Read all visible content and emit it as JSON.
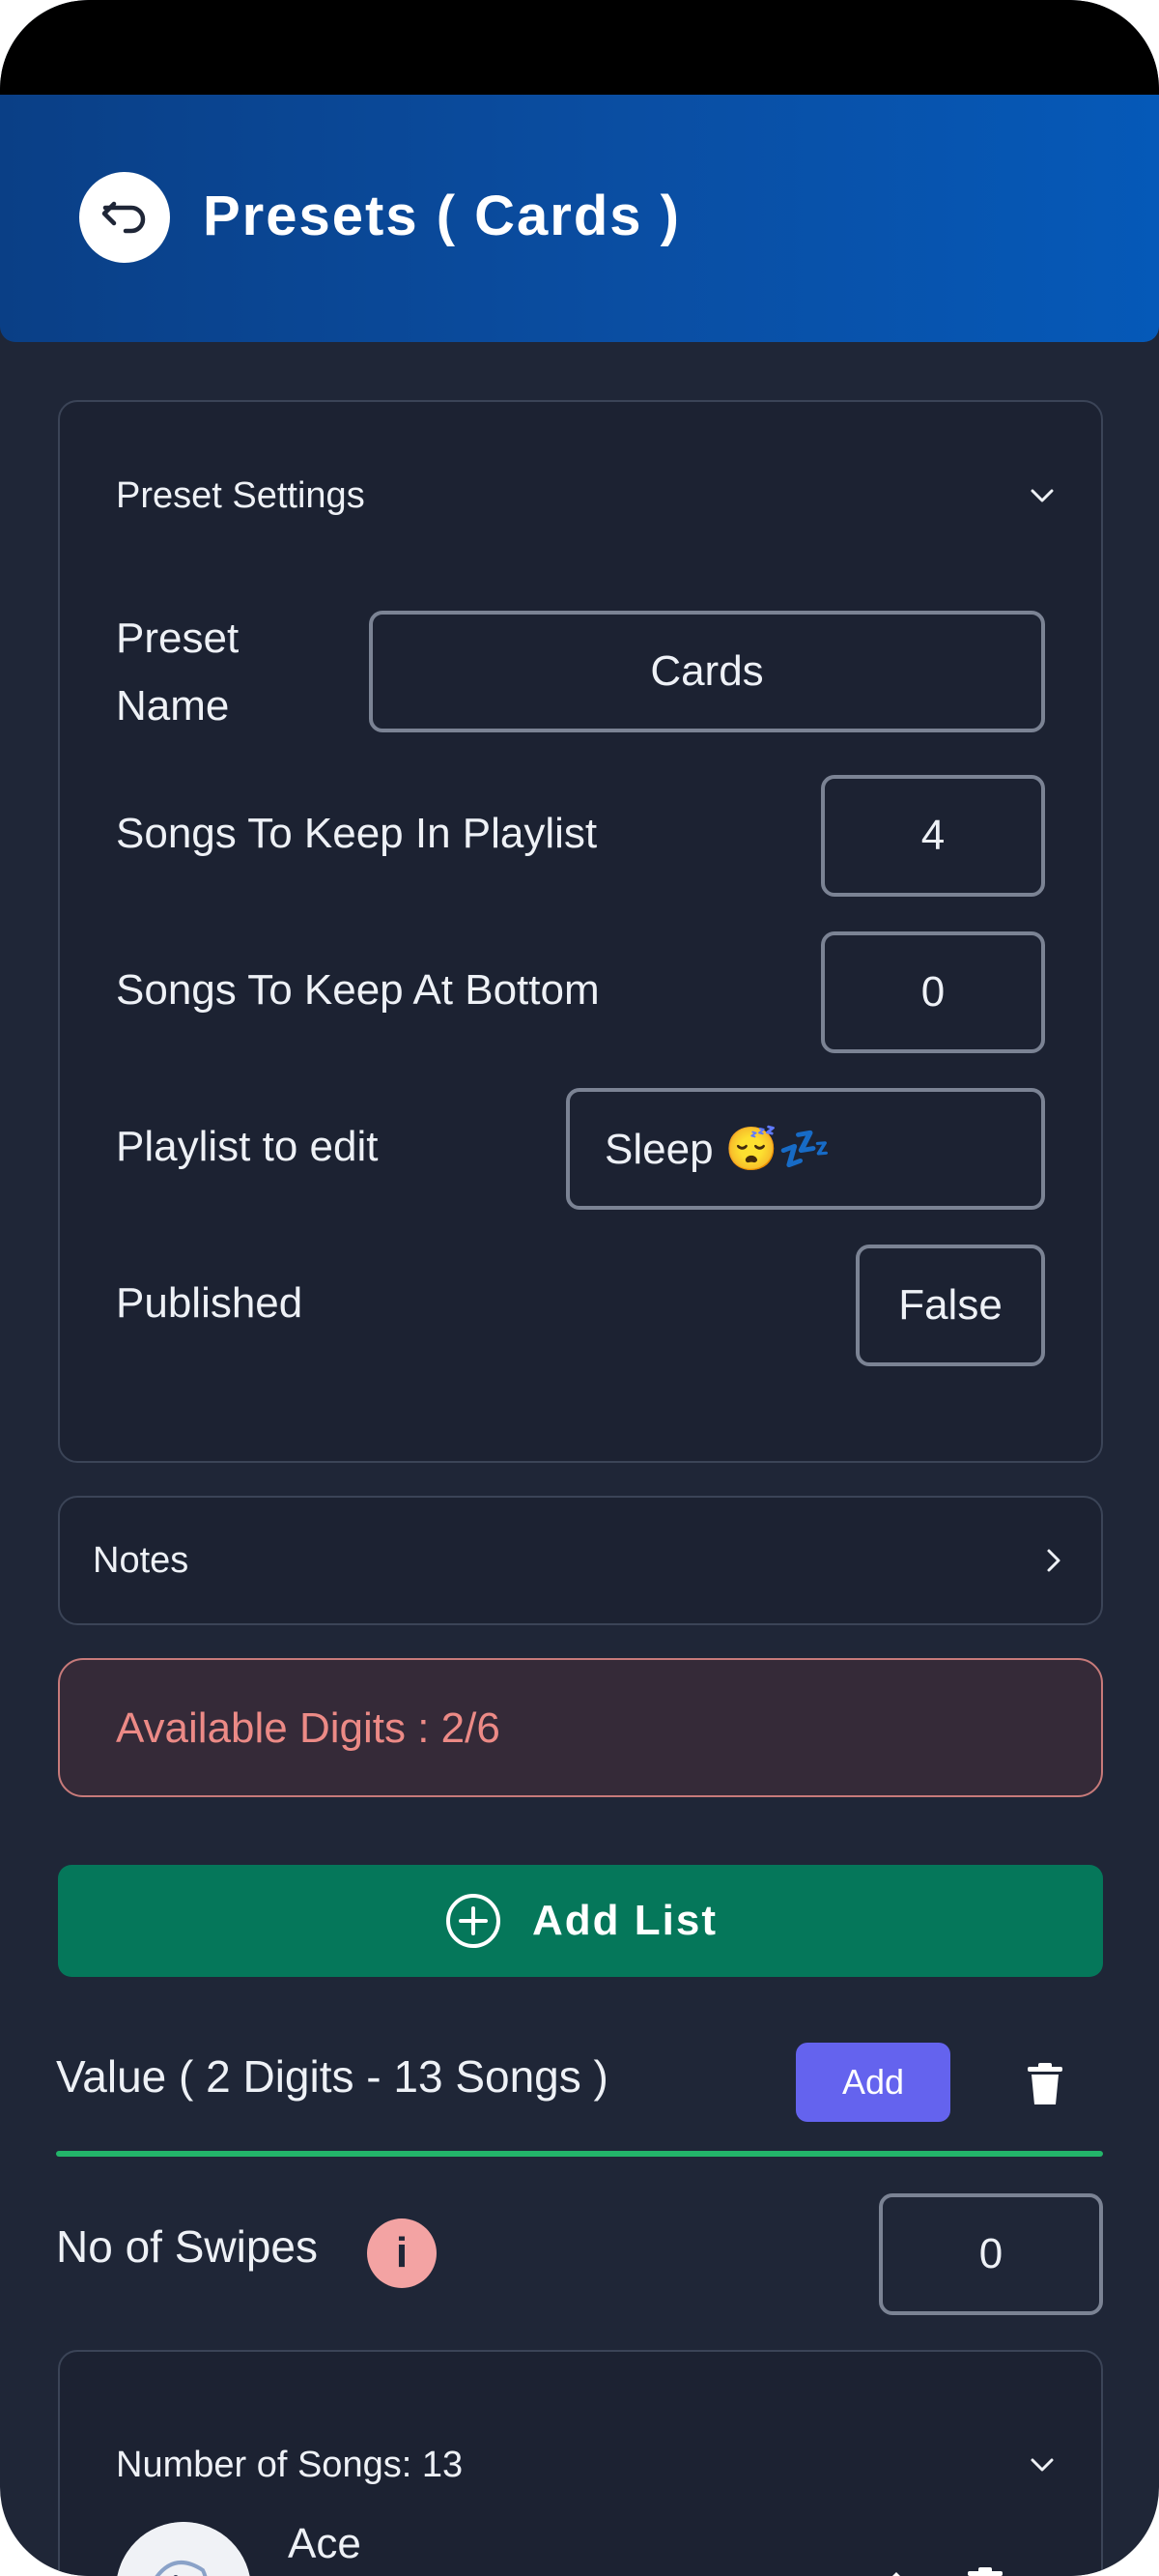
{
  "header": {
    "title": "Presets ( Cards )"
  },
  "preset_settings": {
    "heading": "Preset Settings",
    "preset_name_label": "Preset\nName",
    "preset_name_value": "Cards",
    "songs_keep_playlist_label": "Songs To Keep In Playlist",
    "songs_keep_playlist_value": "4",
    "songs_keep_bottom_label": "Songs To Keep At Bottom",
    "songs_keep_bottom_value": "0",
    "playlist_label": "Playlist to edit",
    "playlist_value": "Sleep 😴💤",
    "published_label": "Published",
    "published_value": "False"
  },
  "notes": {
    "label": "Notes"
  },
  "digits": {
    "text": "Available Digits : 2/6"
  },
  "add_list": {
    "label": "Add List"
  },
  "value_section": {
    "label": "Value ( 2 Digits - 13 Songs )",
    "add_label": "Add",
    "swipes_label": "No of Swipes",
    "swipes_value": "0",
    "info_glyph": "i"
  },
  "songs": {
    "heading": "Number of Songs: 13",
    "first_song": "Ace"
  },
  "colors": {
    "background": "#1f2637",
    "header_gradient_start": "#0a3f86",
    "header_gradient_end": "#0559b8",
    "add_list_green": "#05775a",
    "add_button_purple": "#6463ee",
    "digits_warning": "#ec8a86",
    "divider_green": "#23b56a"
  }
}
